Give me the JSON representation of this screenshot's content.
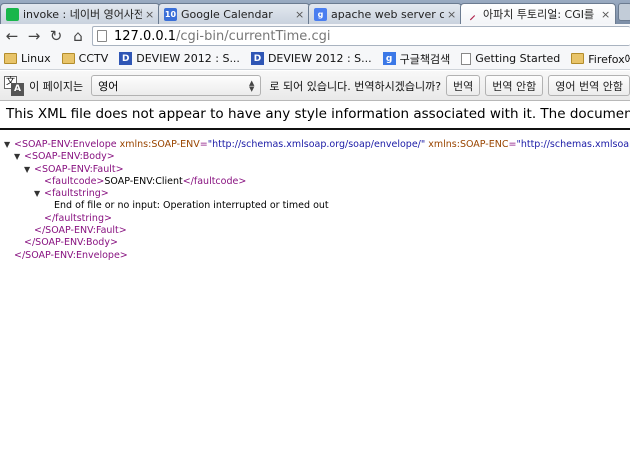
{
  "tabs": [
    {
      "label": "invoke : 네이버 영어사전",
      "icon": "naver-icon",
      "color": "#19b64b",
      "glyph": ""
    },
    {
      "label": "Google Calendar",
      "icon": "calendar-icon",
      "color": "#3a6fd8",
      "glyph": "10"
    },
    {
      "label": "apache web server cgi - G",
      "icon": "google-icon",
      "color": "#4a7ef0",
      "glyph": "g"
    },
    {
      "label": "아파치 투토리얼: CGI를 사용",
      "icon": "apache-feather-icon",
      "color": "#b0224a",
      "glyph": ""
    }
  ],
  "toolbar": {
    "back": "←",
    "forward": "→",
    "reload": "↻",
    "home": "⌂",
    "url_host": "127.0.0.1",
    "url_path": "/cgi-bin/currentTime.cgi"
  },
  "bookmarks": [
    {
      "label": "Linux",
      "icon": "folder-icon"
    },
    {
      "label": "CCTV",
      "icon": "folder-icon"
    },
    {
      "label": "DEVIEW 2012 : S...",
      "icon": "deview-icon"
    },
    {
      "label": "DEVIEW 2012 : S...",
      "icon": "deview-icon"
    },
    {
      "label": "구글책검색",
      "icon": "google-icon"
    },
    {
      "label": "Getting Started",
      "icon": "page-icon"
    },
    {
      "label": "Firefox에서 가져...",
      "icon": "folder-icon"
    }
  ],
  "infobar": {
    "prefix": "이 페이지는",
    "language": "영어",
    "suffix": "로 되어 있습니다. 번역하시겠습니까?",
    "translate_btn": "번역",
    "no_translate_btn": "번역 안함",
    "never_translate_btn": "영어 번역 안함"
  },
  "page": {
    "notice": "This XML file does not appear to have any style information associated with it. The document tree is shown below.",
    "xml": {
      "envelope_open": "<SOAP-ENV:Envelope",
      "attr1_name": "xmlns:SOAP-ENV",
      "attr1_value": "\"http://schemas.xmlsoap.org/soap/envelope/\"",
      "attr2_name": "xmlns:SOAP-ENC",
      "attr2_value": "\"http://schemas.xmlsoap.org/soap/encoding/\"",
      "gt": ">",
      "body_open": "<SOAP-ENV:Body>",
      "fault_open": "<SOAP-ENV:Fault>",
      "faultcode_open": "<faultcode>",
      "faultcode_text": "SOAP-ENV:Client",
      "faultcode_close": "</faultcode>",
      "faultstring_open": "<faultstring>",
      "faultstring_text": "End of file or no input: Operation interrupted or timed out",
      "faultstring_close": "</faultstring>",
      "fault_close": "</SOAP-ENV:Fault>",
      "body_close": "</SOAP-ENV:Body>",
      "envelope_close": "</SOAP-ENV:Envelope>",
      "triangle": "▼"
    }
  }
}
